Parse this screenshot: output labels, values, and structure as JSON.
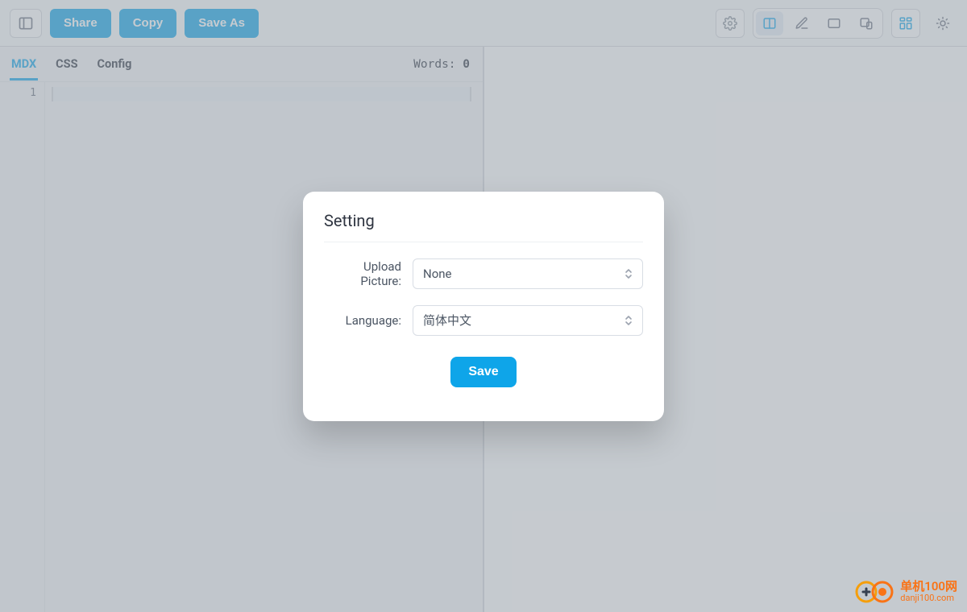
{
  "toolbar": {
    "share_label": "Share",
    "copy_label": "Copy",
    "saveas_label": "Save As"
  },
  "tabs": {
    "items": [
      "MDX",
      "CSS",
      "Config"
    ],
    "active_index": 0
  },
  "wordcount": {
    "label": "Words: ",
    "value": "0"
  },
  "editor": {
    "first_line_no": "1"
  },
  "modal": {
    "title": "Setting",
    "upload_label": "Upload Picture:",
    "upload_value": "None",
    "language_label": "Language:",
    "language_value": "简体中文",
    "save_label": "Save"
  },
  "watermark": {
    "line1": "单机100网",
    "line2": "danji100.com"
  }
}
